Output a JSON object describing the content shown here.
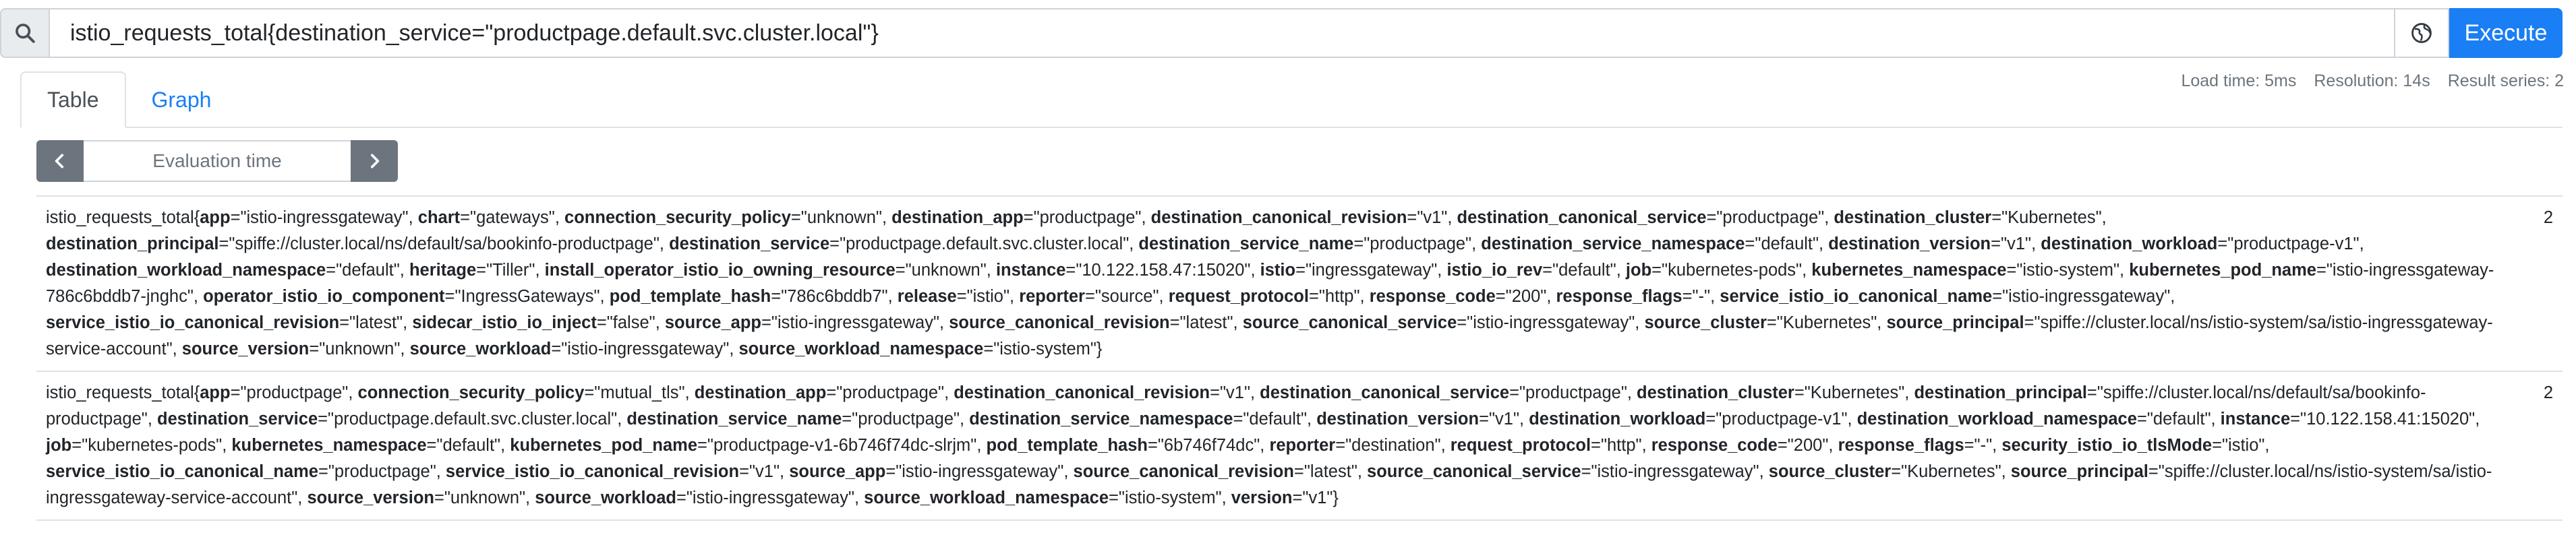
{
  "query": {
    "expression": "istio_requests_total{destination_service=\"productpage.default.svc.cluster.local\"}",
    "execute_label": "Execute",
    "search_icon": "search-icon",
    "metrics_icon": "globe-icon"
  },
  "tabs": [
    {
      "label": "Table",
      "active": true
    },
    {
      "label": "Graph",
      "active": false
    }
  ],
  "stats": {
    "load_time": "Load time: 5ms",
    "resolution": "Resolution: 14s",
    "result_series": "Result series: 2"
  },
  "eval": {
    "placeholder": "Evaluation time",
    "prev_icon": "chevron-left-icon",
    "next_icon": "chevron-right-icon"
  },
  "results": [
    {
      "metric": "istio_requests_total",
      "value": "2",
      "labels": [
        [
          "app",
          "istio-ingressgateway"
        ],
        [
          "chart",
          "gateways"
        ],
        [
          "connection_security_policy",
          "unknown"
        ],
        [
          "destination_app",
          "productpage"
        ],
        [
          "destination_canonical_revision",
          "v1"
        ],
        [
          "destination_canonical_service",
          "productpage"
        ],
        [
          "destination_cluster",
          "Kubernetes"
        ],
        [
          "destination_principal",
          "spiffe://cluster.local/ns/default/sa/bookinfo-productpage"
        ],
        [
          "destination_service",
          "productpage.default.svc.cluster.local"
        ],
        [
          "destination_service_name",
          "productpage"
        ],
        [
          "destination_service_namespace",
          "default"
        ],
        [
          "destination_version",
          "v1"
        ],
        [
          "destination_workload",
          "productpage-v1"
        ],
        [
          "destination_workload_namespace",
          "default"
        ],
        [
          "heritage",
          "Tiller"
        ],
        [
          "install_operator_istio_io_owning_resource",
          "unknown"
        ],
        [
          "instance",
          "10.122.158.47:15020"
        ],
        [
          "istio",
          "ingressgateway"
        ],
        [
          "istio_io_rev",
          "default"
        ],
        [
          "job",
          "kubernetes-pods"
        ],
        [
          "kubernetes_namespace",
          "istio-system"
        ],
        [
          "kubernetes_pod_name",
          "istio-ingressgateway-786c6bddb7-jnghc"
        ],
        [
          "operator_istio_io_component",
          "IngressGateways"
        ],
        [
          "pod_template_hash",
          "786c6bddb7"
        ],
        [
          "release",
          "istio"
        ],
        [
          "reporter",
          "source"
        ],
        [
          "request_protocol",
          "http"
        ],
        [
          "response_code",
          "200"
        ],
        [
          "response_flags",
          "-"
        ],
        [
          "service_istio_io_canonical_name",
          "istio-ingressgateway"
        ],
        [
          "service_istio_io_canonical_revision",
          "latest"
        ],
        [
          "sidecar_istio_io_inject",
          "false"
        ],
        [
          "source_app",
          "istio-ingressgateway"
        ],
        [
          "source_canonical_revision",
          "latest"
        ],
        [
          "source_canonical_service",
          "istio-ingressgateway"
        ],
        [
          "source_cluster",
          "Kubernetes"
        ],
        [
          "source_principal",
          "spiffe://cluster.local/ns/istio-system/sa/istio-ingressgateway-service-account"
        ],
        [
          "source_version",
          "unknown"
        ],
        [
          "source_workload",
          "istio-ingressgateway"
        ],
        [
          "source_workload_namespace",
          "istio-system"
        ]
      ]
    },
    {
      "metric": "istio_requests_total",
      "value": "2",
      "labels": [
        [
          "app",
          "productpage"
        ],
        [
          "connection_security_policy",
          "mutual_tls"
        ],
        [
          "destination_app",
          "productpage"
        ],
        [
          "destination_canonical_revision",
          "v1"
        ],
        [
          "destination_canonical_service",
          "productpage"
        ],
        [
          "destination_cluster",
          "Kubernetes"
        ],
        [
          "destination_principal",
          "spiffe://cluster.local/ns/default/sa/bookinfo-productpage"
        ],
        [
          "destination_service",
          "productpage.default.svc.cluster.local"
        ],
        [
          "destination_service_name",
          "productpage"
        ],
        [
          "destination_service_namespace",
          "default"
        ],
        [
          "destination_version",
          "v1"
        ],
        [
          "destination_workload",
          "productpage-v1"
        ],
        [
          "destination_workload_namespace",
          "default"
        ],
        [
          "instance",
          "10.122.158.41:15020"
        ],
        [
          "job",
          "kubernetes-pods"
        ],
        [
          "kubernetes_namespace",
          "default"
        ],
        [
          "kubernetes_pod_name",
          "productpage-v1-6b746f74dc-slrjm"
        ],
        [
          "pod_template_hash",
          "6b746f74dc"
        ],
        [
          "reporter",
          "destination"
        ],
        [
          "request_protocol",
          "http"
        ],
        [
          "response_code",
          "200"
        ],
        [
          "response_flags",
          "-"
        ],
        [
          "security_istio_io_tlsMode",
          "istio"
        ],
        [
          "service_istio_io_canonical_name",
          "productpage"
        ],
        [
          "service_istio_io_canonical_revision",
          "v1"
        ],
        [
          "source_app",
          "istio-ingressgateway"
        ],
        [
          "source_canonical_revision",
          "latest"
        ],
        [
          "source_canonical_service",
          "istio-ingressgateway"
        ],
        [
          "source_cluster",
          "Kubernetes"
        ],
        [
          "source_principal",
          "spiffe://cluster.local/ns/istio-system/sa/istio-ingressgateway-service-account"
        ],
        [
          "source_version",
          "unknown"
        ],
        [
          "source_workload",
          "istio-ingressgateway"
        ],
        [
          "source_workload_namespace",
          "istio-system"
        ],
        [
          "version",
          "v1"
        ]
      ]
    }
  ]
}
